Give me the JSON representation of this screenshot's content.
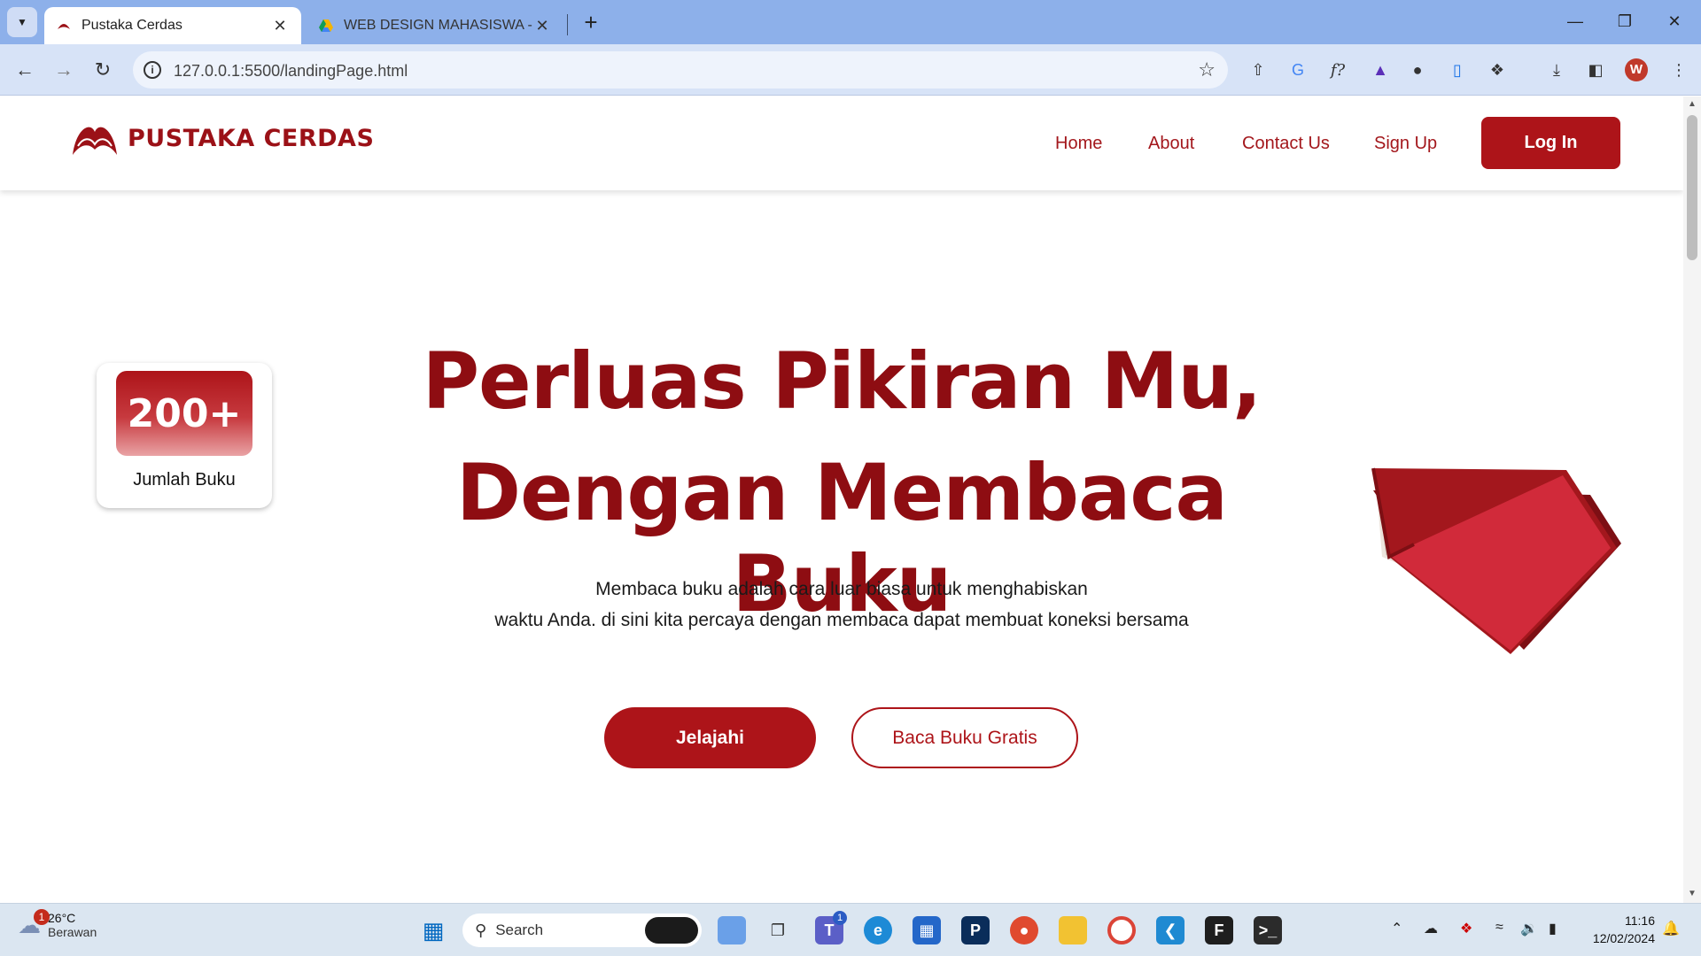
{
  "browser": {
    "tabs": [
      {
        "title": "Pustaka Cerdas",
        "active": true
      },
      {
        "title": "WEB DESIGN MAHASISWA - Go",
        "active": false
      }
    ],
    "url": "127.0.0.1:5500/landingPage.html",
    "profile_initial": "W"
  },
  "site": {
    "brand": "PUSTAKA CERDAS",
    "nav": [
      "Home",
      "About",
      "Contact Us",
      "Sign Up"
    ],
    "login_label": "Log In",
    "stat": {
      "value": "200+",
      "label": "Jumlah Buku"
    },
    "hero": {
      "title_line1": "Perluas Pikiran Mu,",
      "title_line2": "Dengan Membaca Buku",
      "subtitle_line1": "Membaca buku adalah cara luar biasa untuk menghabiskan",
      "subtitle_line2": "waktu Anda. di sini kita percaya dengan membaca dapat membuat koneksi bersama"
    },
    "cta_primary": "Jelajahi",
    "cta_secondary": "Baca Buku Gratis",
    "colors": {
      "brand": "#ad1419",
      "heading": "#8e0d12"
    }
  },
  "taskbar": {
    "weather_temp": "26°C",
    "weather_desc": "Berawan",
    "weather_badge": "1",
    "search_label": "Search",
    "teams_badge": "1",
    "time": "11:16",
    "date": "12/02/2024"
  }
}
